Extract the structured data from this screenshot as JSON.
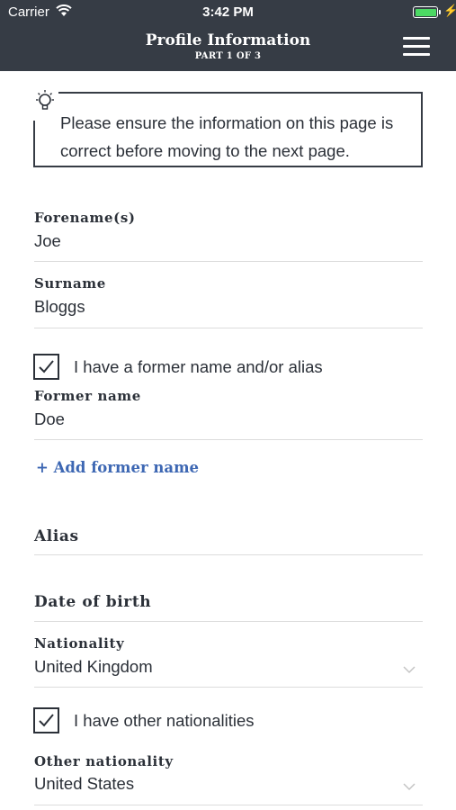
{
  "status_bar": {
    "carrier": "Carrier",
    "time": "3:42 PM",
    "battery_level": 1.0,
    "battery_color": "#4cd964"
  },
  "nav": {
    "title": "Profile Information",
    "subtitle": "PART 1 OF 3",
    "menu_icon": "hamburger-menu-icon",
    "background": "#363c45"
  },
  "info": {
    "icon": "lightbulb-icon",
    "text": "Please ensure the information on this page is correct before moving to the next page."
  },
  "fields": {
    "forename": {
      "label": "Forename(s)",
      "value": "Joe"
    },
    "surname": {
      "label": "Surname",
      "value": "Bloggs"
    },
    "former_name_checkbox": {
      "label": "I have a former name and/or alias",
      "checked": true
    },
    "former_name": {
      "label": "Former name",
      "value": "Doe"
    },
    "add_former_name": "+ Add former name",
    "alias": {
      "label": "Alias",
      "value": ""
    },
    "date_of_birth": {
      "label": "Date of birth",
      "value": ""
    },
    "nationality": {
      "label": "Nationality",
      "value": "United Kingdom"
    },
    "other_nationalities_checkbox": {
      "label": "I have other nationalities",
      "checked": true
    },
    "other_nationality": {
      "label": "Other nationality",
      "value": "United States"
    }
  },
  "colors": {
    "link": "#3d67b3",
    "text": "#2b3038"
  }
}
